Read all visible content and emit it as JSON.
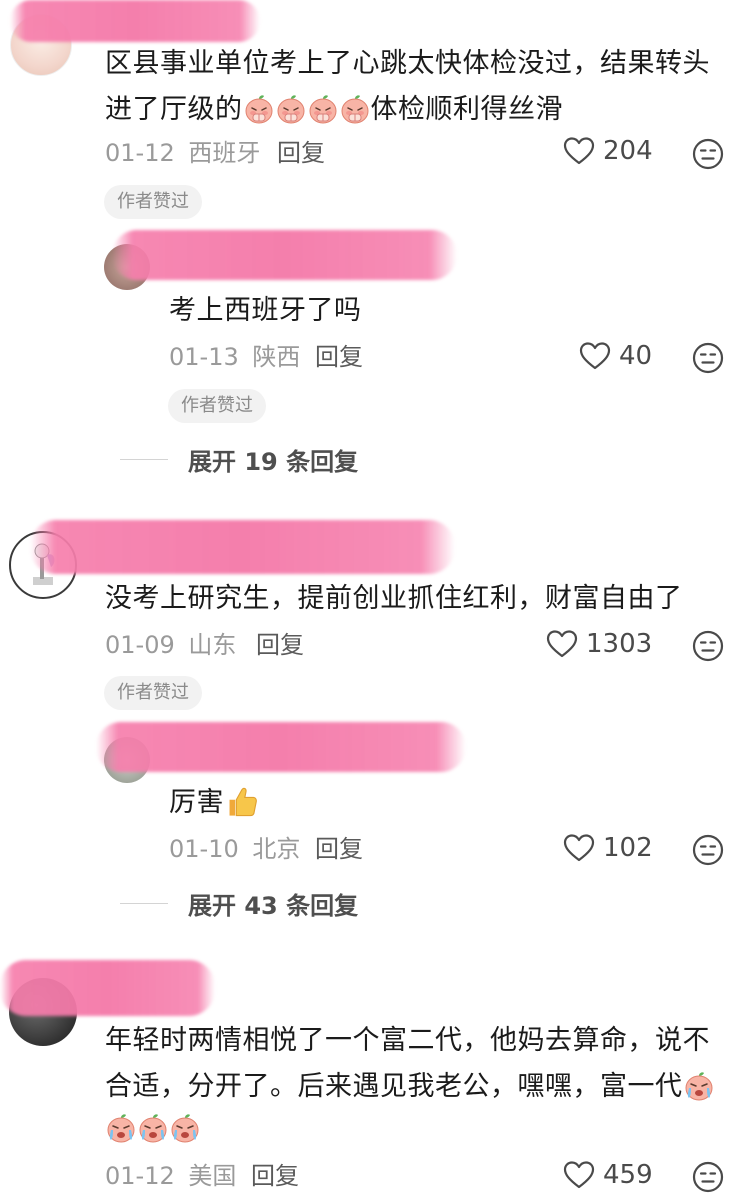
{
  "comments": [
    {
      "text_line1": "区县事业单位考上了心跳太快体检没过，结果转头",
      "text_line2_prefix": "进了厅级的",
      "text_line2_suffix": "体检顺利得丝滑",
      "date": "01-12",
      "location": "西班牙",
      "reply_label": "回复",
      "likes": "204",
      "badge": "作者赞过",
      "reply": {
        "text": "考上西班牙了吗",
        "date": "01-13",
        "location": "陕西",
        "reply_label": "回复",
        "likes": "40",
        "badge": "作者赞过"
      },
      "expand": "展开 19 条回复"
    },
    {
      "text": "没考上研究生，提前创业抓住红利，财富自由了",
      "date": "01-09",
      "location": "山东",
      "reply_label": "回复",
      "likes": "1303",
      "badge": "作者赞过",
      "reply": {
        "text": "厉害",
        "date": "01-10",
        "location": "北京",
        "reply_label": "回复",
        "likes": "102"
      },
      "expand": "展开 43 条回复"
    },
    {
      "text_line1": "年轻时两情相悦了一个富二代，他妈去算命，说不",
      "text_line2": "合适，分开了。后来遇见我老公，嘿嘿，富一代",
      "date": "01-12",
      "location": "美国",
      "reply_label": "回复",
      "likes": "459"
    }
  ],
  "icons": {
    "like": "heart-outline-icon",
    "dislike": "neutral-face-icon",
    "emoji_peach_pleading": "peach-pleading-emoji",
    "emoji_peach_crying": "peach-crying-emoji",
    "emoji_thumbs_up": "thumbs-up-emoji"
  },
  "colors": {
    "username_blur": "#f47aa8",
    "meta_gray": "#9a9a9a",
    "badge_bg": "#f2f2f2"
  }
}
